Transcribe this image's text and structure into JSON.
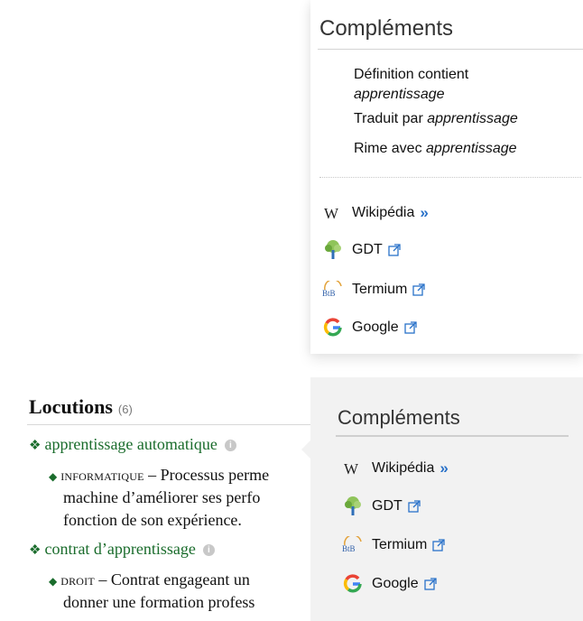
{
  "top_panel": {
    "title": "Compléments",
    "searches": [
      {
        "prefix": "Définition contient",
        "term": "apprentissage"
      },
      {
        "prefix": "Traduit par ",
        "term": "apprentissage"
      },
      {
        "prefix": "Rime avec ",
        "term": "apprentissage"
      }
    ],
    "links": [
      {
        "label": "Wikipédia",
        "icon": "wikipedia-icon",
        "suffix": "»"
      },
      {
        "label": "GDT",
        "icon": "gdt-tree-icon"
      },
      {
        "label": "Termium",
        "icon": "btb-termium-icon"
      },
      {
        "label": "Google",
        "icon": "google-icon"
      }
    ]
  },
  "article": {
    "section_title": "Locutions",
    "section_count": "(6)",
    "entries": [
      {
        "term": "apprentissage automatique",
        "domain": "Informatique",
        "lines": [
          "– Processus perme",
          "machine d’améliorer ses perfo",
          "fonction de son expérience."
        ]
      },
      {
        "term": "contrat d’apprentissage",
        "domain": "Droit",
        "lines": [
          "– Contrat engageant un",
          "donner une formation profess"
        ]
      }
    ]
  },
  "bottom_panel": {
    "title": "Compléments",
    "links": [
      {
        "label": "Wikipédia",
        "suffix": "»"
      },
      {
        "label": "GDT"
      },
      {
        "label": "Termium"
      },
      {
        "label": "Google"
      }
    ]
  },
  "colors": {
    "link_blue": "#2a72c9",
    "term_green": "#1a6c2c",
    "panel_gray": "#f2f2f2"
  }
}
